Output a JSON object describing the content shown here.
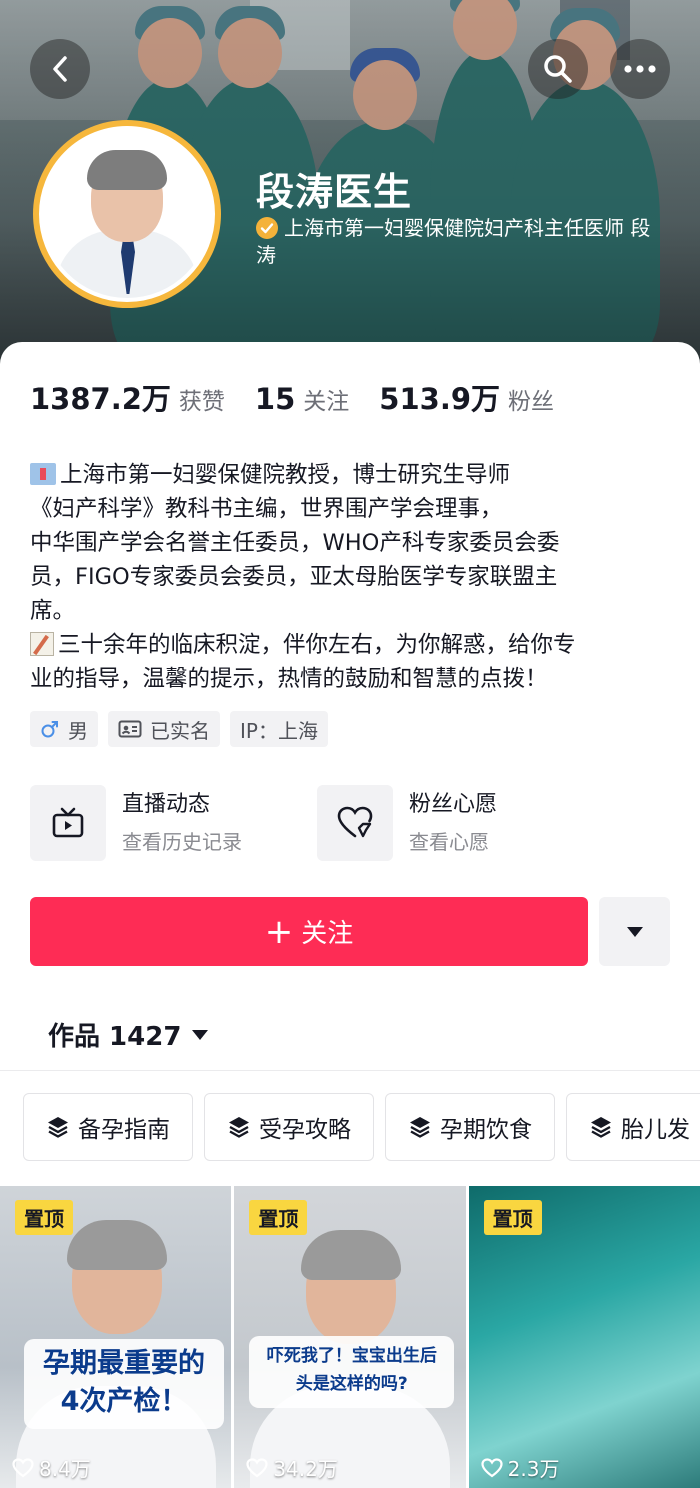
{
  "profile": {
    "name": "段涛医生",
    "verification": "上海市第一妇婴保健院妇产科主任医师 段涛",
    "colors": {
      "avatar_ring": "#f6b73c",
      "verify_badge": "#f4b23a"
    }
  },
  "stats": {
    "likes_value": "1387.2万",
    "likes_label": "获赞",
    "following_value": "15",
    "following_label": "关注",
    "fans_value": "513.9万",
    "fans_label": "粉丝"
  },
  "bio": {
    "lines": [
      "上海市第一妇婴保健院教授，博士研究生导师",
      "《妇产科学》教科书主编，世界围产学会理事，",
      "中华围产学会名誉主任委员，WHO产科专家委员会委",
      "员，FIGO专家委员会委员，亚太母胎医学专家联盟主",
      "席。",
      "三十余年的临床积淀，伴你左右，为你解惑，给你专",
      "业的指导，温馨的提示，热情的鼓励和智慧的点拨！"
    ]
  },
  "tags": {
    "gender": "男",
    "realname": "已实名",
    "ip": "IP：上海"
  },
  "features": {
    "live": {
      "title": "直播动态",
      "subtitle": "查看历史记录",
      "icon": "tv-icon"
    },
    "wish": {
      "title": "粉丝心愿",
      "subtitle": "查看心愿",
      "icon": "heart-wish-icon"
    }
  },
  "actions": {
    "follow_label": "关注",
    "follow_color": "#fe2c55"
  },
  "works": {
    "tab_label": "作品 1427"
  },
  "categories": [
    "备孕指南",
    "受孕攻略",
    "孕期饮食",
    "胎儿发"
  ],
  "videos": [
    {
      "pin": "置顶",
      "caption": "孕期最重要的4次产检！",
      "caption_lines": [
        "孕期最重要的",
        "4次产检！"
      ],
      "likes": "8.4万"
    },
    {
      "pin": "置顶",
      "caption": "吓死我了！宝宝出生后头是这样的吗?",
      "caption_lines": [
        "吓死我了！宝宝出生后",
        "头是这样的吗?"
      ],
      "likes": "34.2万"
    },
    {
      "pin": "置顶",
      "likes": "2.3万"
    }
  ]
}
